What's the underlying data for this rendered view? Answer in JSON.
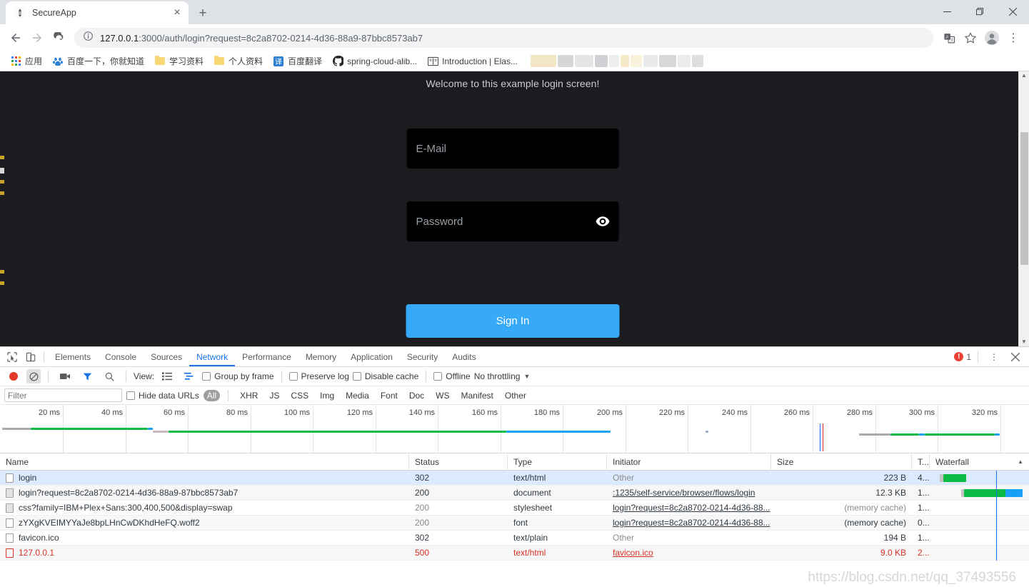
{
  "browser": {
    "tab": {
      "title": "SecureApp",
      "favicon": "globe-icon",
      "close": "×"
    },
    "new_tab": "+",
    "window_controls": {
      "minimize": "—",
      "maximize": "❐",
      "close": "✕"
    },
    "nav": {
      "back": "←",
      "forward": "→",
      "reload": "↻",
      "info": "ⓘ"
    },
    "url": {
      "scheme_host": "127.0.0.1",
      "rest": ":3000/auth/login?request=8c2a8702-0214-4d36-88a9-87bbc8573ab7"
    },
    "toolbar_right": {
      "translate": "translate-icon",
      "bookmark": "☆",
      "profile": "avatar-icon",
      "menu": "⋮"
    },
    "bookmarks": [
      {
        "label": "应用",
        "icon": "apps-grid-icon"
      },
      {
        "label": "百度一下，你就知道",
        "icon": "baidu-icon"
      },
      {
        "label": "学习资料",
        "icon": "folder-icon"
      },
      {
        "label": "个人资料",
        "icon": "folder-icon"
      },
      {
        "label": "百度翻译",
        "icon": "translate-badge-icon"
      },
      {
        "label": "spring-cloud-alib...",
        "icon": "github-icon"
      },
      {
        "label": "Introduction | Elas...",
        "icon": "book-icon"
      }
    ]
  },
  "page": {
    "welcome": "Welcome to this example login screen!",
    "email_placeholder": "E-Mail",
    "password_placeholder": "Password",
    "reveal_icon": "eye-icon",
    "submit_label": "Sign In",
    "accent_color": "#36a9f8",
    "background_color": "#1b1b20",
    "field_color": "#000000"
  },
  "devtools": {
    "panels": [
      "Elements",
      "Console",
      "Sources",
      "Network",
      "Performance",
      "Memory",
      "Application",
      "Security",
      "Audits"
    ],
    "active_panel": "Network",
    "inspect_icon": "inspect-cursor-icon",
    "device_icon": "device-toolbar-icon",
    "error_count": "1",
    "more_menu": "⋮",
    "close": "✕",
    "network_toolbar": {
      "record": "record-icon",
      "clear": "clear-icon",
      "capture_screenshots": "camera-icon",
      "filter": "funnel-icon",
      "search": "search-icon",
      "view_label": "View:",
      "view_list": "list-view-icon",
      "view_waterfall": "waterfall-view-icon",
      "group_by_frame": "Group by frame",
      "preserve_log": "Preserve log",
      "disable_cache": "Disable cache",
      "offline": "Offline",
      "throttling": "No throttling",
      "throttling_caret": "▼"
    },
    "filter_bar": {
      "placeholder": "Filter",
      "hide_data_urls": "Hide data URLs",
      "types": [
        "All",
        "XHR",
        "JS",
        "CSS",
        "Img",
        "Media",
        "Font",
        "Doc",
        "WS",
        "Manifest",
        "Other"
      ],
      "selected_type": "All"
    },
    "timeline": {
      "ticks": [
        "20 ms",
        "40 ms",
        "60 ms",
        "80 ms",
        "100 ms",
        "120 ms",
        "140 ms",
        "160 ms",
        "180 ms",
        "200 ms",
        "220 ms",
        "240 ms",
        "260 ms",
        "280 ms",
        "300 ms",
        "320 ms"
      ]
    },
    "columns": [
      "Name",
      "Status",
      "Type",
      "Initiator",
      "Size",
      "T...",
      "Waterfall"
    ],
    "sort_indicator": "▲",
    "requests": [
      {
        "name": "login",
        "status": "302",
        "type": "text/html",
        "initiator": "Other",
        "initiator_link": false,
        "size": "223 B",
        "time": "4...",
        "selected": true,
        "error": false,
        "icon": "blank-file-icon"
      },
      {
        "name": "login?request=8c2a8702-0214-4d36-88a9-87bbc8573ab7",
        "status": "200",
        "type": "document",
        "initiator": ":1235/self-service/browser/flows/login",
        "initiator_link": true,
        "size": "12.3 KB",
        "time": "1...",
        "selected": false,
        "error": false,
        "icon": "document-file-icon"
      },
      {
        "name": "css?family=IBM+Plex+Sans:300,400,500&display=swap",
        "status": "200",
        "type": "stylesheet",
        "initiator": "login?request=8c2a8702-0214-4d36-88...",
        "initiator_link": true,
        "size": "(memory cache)",
        "time": "1...",
        "selected": false,
        "error": false,
        "icon": "document-file-icon"
      },
      {
        "name": "zYXgKVEIMYYaJe8bpLHnCwDKhdHeFQ.woff2",
        "status": "200",
        "type": "font",
        "initiator": "login?request=8c2a8702-0214-4d36-88...",
        "initiator_link": true,
        "size": "(memory cache)",
        "time": "0...",
        "selected": false,
        "error": false,
        "icon": "blank-file-icon"
      },
      {
        "name": "favicon.ico",
        "status": "302",
        "type": "text/plain",
        "initiator": "Other",
        "initiator_link": false,
        "size": "194 B",
        "time": "1...",
        "selected": false,
        "error": false,
        "icon": "blank-file-icon"
      },
      {
        "name": "127.0.0.1",
        "status": "500",
        "type": "text/html",
        "initiator": "favicon.ico",
        "initiator_link": true,
        "size": "9.0 KB",
        "time": "2...",
        "selected": false,
        "error": true,
        "icon": "blank-file-icon"
      }
    ]
  },
  "watermark": "https://blog.csdn.net/qq_37493556"
}
